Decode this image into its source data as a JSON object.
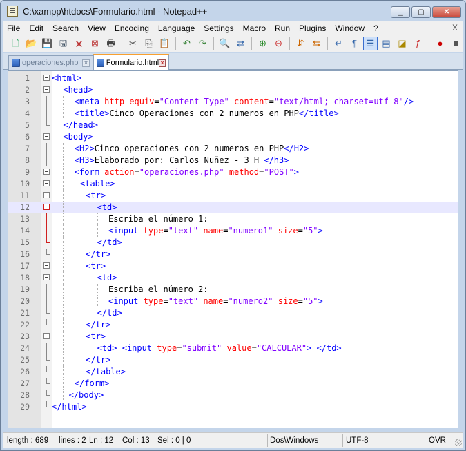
{
  "window": {
    "title": "C:\\xampp\\htdocs\\Formulario.html - Notepad++"
  },
  "title_buttons": {
    "minimize": "▁",
    "maximize": "▢",
    "close": "✕"
  },
  "menu": [
    "File",
    "Edit",
    "Search",
    "View",
    "Encoding",
    "Language",
    "Settings",
    "Macro",
    "Run",
    "Plugins",
    "Window",
    "?"
  ],
  "menu_close": "X",
  "toolbar": [
    {
      "name": "new-file-icon",
      "glyph": "🗋",
      "color": "#3a6"
    },
    {
      "name": "open-file-icon",
      "glyph": "📂",
      "color": "#c90"
    },
    {
      "name": "save-icon",
      "glyph": "💾",
      "color": "#456"
    },
    {
      "name": "save-all-icon",
      "glyph": "🖫",
      "color": "#456"
    },
    {
      "name": "close-icon",
      "glyph": "🗙",
      "color": "#b33"
    },
    {
      "name": "close-all-icon",
      "glyph": "⊠",
      "color": "#b33"
    },
    {
      "name": "print-icon",
      "glyph": "🖶",
      "color": "#444"
    },
    {
      "sep": true
    },
    {
      "name": "cut-icon",
      "glyph": "✂",
      "color": "#555"
    },
    {
      "name": "copy-icon",
      "glyph": "⎘",
      "color": "#555"
    },
    {
      "name": "paste-icon",
      "glyph": "📋",
      "color": "#a70"
    },
    {
      "sep": true
    },
    {
      "name": "undo-icon",
      "glyph": "↶",
      "color": "#2a7a2a"
    },
    {
      "name": "redo-icon",
      "glyph": "↷",
      "color": "#2a7a2a"
    },
    {
      "sep": true
    },
    {
      "name": "find-icon",
      "glyph": "🔍",
      "color": "#333"
    },
    {
      "name": "replace-icon",
      "glyph": "⇄",
      "color": "#36a"
    },
    {
      "sep": true
    },
    {
      "name": "zoom-in-icon",
      "glyph": "⊕",
      "color": "#2a8a2a"
    },
    {
      "name": "zoom-out-icon",
      "glyph": "⊖",
      "color": "#c33"
    },
    {
      "sep": true
    },
    {
      "name": "sync-vertical-icon",
      "glyph": "⇵",
      "color": "#c60"
    },
    {
      "name": "sync-horizontal-icon",
      "glyph": "⇆",
      "color": "#c60"
    },
    {
      "sep": true
    },
    {
      "name": "word-wrap-icon",
      "glyph": "↵",
      "color": "#36a"
    },
    {
      "name": "show-all-characters-icon",
      "glyph": "¶",
      "color": "#36a"
    },
    {
      "name": "indent-guide-icon",
      "glyph": "☰",
      "color": "#36a",
      "active": true
    },
    {
      "name": "user-language-icon",
      "glyph": "▤",
      "color": "#36a"
    },
    {
      "name": "document-map-icon",
      "glyph": "◪",
      "color": "#a80"
    },
    {
      "name": "function-list-icon",
      "glyph": "ƒ",
      "color": "#c33"
    },
    {
      "sep": true
    },
    {
      "name": "record-macro-icon",
      "glyph": "●",
      "color": "#c00"
    },
    {
      "name": "stop-record-icon",
      "glyph": "■",
      "color": "#555"
    }
  ],
  "tabs": [
    {
      "label": "operaciones.php",
      "active": false
    },
    {
      "label": "Formulario.html",
      "active": true
    }
  ],
  "editor": {
    "current_line": 12,
    "lines": [
      {
        "n": "1",
        "indent": 0,
        "fold": "box",
        "tokens": [
          [
            "t",
            "<html>"
          ]
        ]
      },
      {
        "n": "2",
        "indent": 2,
        "fold": "box",
        "tokens": [
          [
            "t",
            "<head>"
          ]
        ]
      },
      {
        "n": "3",
        "indent": 4,
        "fold": "line",
        "tokens": [
          [
            "t",
            "<meta "
          ],
          [
            "a",
            "http-equiv"
          ],
          [
            "p",
            "="
          ],
          [
            "v",
            "\"Content-Type\""
          ],
          [
            "p",
            " "
          ],
          [
            "a",
            "content"
          ],
          [
            "p",
            "="
          ],
          [
            "v",
            "\"text/html; charset=utf-8\""
          ],
          [
            "t",
            "/>"
          ]
        ]
      },
      {
        "n": "4",
        "indent": 4,
        "fold": "line",
        "tokens": [
          [
            "t",
            "<title>"
          ],
          [
            "p",
            "Cinco Operaciones con 2 numeros en PHP"
          ],
          [
            "t",
            "</title>"
          ]
        ]
      },
      {
        "n": "5",
        "indent": 2,
        "fold": "end",
        "tokens": [
          [
            "t",
            "</head>"
          ]
        ]
      },
      {
        "n": "6",
        "indent": 2,
        "fold": "box",
        "tokens": [
          [
            "t",
            "<body>"
          ]
        ]
      },
      {
        "n": "7",
        "indent": 4,
        "fold": "line",
        "tokens": [
          [
            "t",
            "<H2>"
          ],
          [
            "p",
            "Cinco operaciones con 2 numeros en PHP"
          ],
          [
            "t",
            "</H2>"
          ]
        ]
      },
      {
        "n": "8",
        "indent": 4,
        "fold": "line",
        "tokens": [
          [
            "t",
            "<H3>"
          ],
          [
            "p",
            "Elaborado por: Carlos Nuñez - 3 H "
          ],
          [
            "t",
            "</h3>"
          ]
        ]
      },
      {
        "n": "9",
        "indent": 4,
        "fold": "box",
        "tokens": [
          [
            "t",
            "<form "
          ],
          [
            "a",
            "action"
          ],
          [
            "p",
            "="
          ],
          [
            "v",
            "\"operaciones.php\""
          ],
          [
            "p",
            " "
          ],
          [
            "a",
            "method"
          ],
          [
            "p",
            "="
          ],
          [
            "v",
            "\"POST\""
          ],
          [
            "t",
            ">"
          ]
        ]
      },
      {
        "n": "10",
        "indent": 5,
        "fold": "box",
        "tokens": [
          [
            "t",
            "<table>"
          ]
        ]
      },
      {
        "n": "11",
        "indent": 6,
        "fold": "box",
        "tokens": [
          [
            "t",
            "<tr>"
          ]
        ]
      },
      {
        "n": "12",
        "indent": 8,
        "fold": "boxred",
        "tokens": [
          [
            "t",
            "<td>"
          ]
        ]
      },
      {
        "n": "13",
        "indent": 10,
        "fold": "linered",
        "tokens": [
          [
            "p",
            "Escriba el número 1:"
          ]
        ]
      },
      {
        "n": "14",
        "indent": 10,
        "fold": "linered",
        "tokens": [
          [
            "t",
            "<input "
          ],
          [
            "a",
            "type"
          ],
          [
            "p",
            "="
          ],
          [
            "v",
            "\"text\""
          ],
          [
            "p",
            " "
          ],
          [
            "a",
            "name"
          ],
          [
            "p",
            "="
          ],
          [
            "v",
            "\"numero1\""
          ],
          [
            "p",
            " "
          ],
          [
            "a",
            "size"
          ],
          [
            "p",
            "="
          ],
          [
            "v",
            "\"5\""
          ],
          [
            "t",
            ">"
          ]
        ]
      },
      {
        "n": "15",
        "indent": 8,
        "fold": "endred",
        "tokens": [
          [
            "t",
            "</td>"
          ]
        ]
      },
      {
        "n": "16",
        "indent": 6,
        "fold": "end",
        "tokens": [
          [
            "t",
            "</tr>"
          ]
        ]
      },
      {
        "n": "17",
        "indent": 6,
        "fold": "box",
        "tokens": [
          [
            "t",
            "<tr>"
          ]
        ]
      },
      {
        "n": "18",
        "indent": 8,
        "fold": "box",
        "tokens": [
          [
            "t",
            "<td>"
          ]
        ]
      },
      {
        "n": "19",
        "indent": 10,
        "fold": "line",
        "tokens": [
          [
            "p",
            "Escriba el número 2:"
          ]
        ]
      },
      {
        "n": "20",
        "indent": 10,
        "fold": "line",
        "tokens": [
          [
            "t",
            "<input "
          ],
          [
            "a",
            "type"
          ],
          [
            "p",
            "="
          ],
          [
            "v",
            "\"text\""
          ],
          [
            "p",
            " "
          ],
          [
            "a",
            "name"
          ],
          [
            "p",
            "="
          ],
          [
            "v",
            "\"numero2\""
          ],
          [
            "p",
            " "
          ],
          [
            "a",
            "size"
          ],
          [
            "p",
            "="
          ],
          [
            "v",
            "\"5\""
          ],
          [
            "t",
            ">"
          ]
        ]
      },
      {
        "n": "21",
        "indent": 8,
        "fold": "end",
        "tokens": [
          [
            "t",
            "</td>"
          ]
        ]
      },
      {
        "n": "22",
        "indent": 6,
        "fold": "end",
        "tokens": [
          [
            "t",
            "</tr>"
          ]
        ]
      },
      {
        "n": "23",
        "indent": 6,
        "fold": "box",
        "tokens": [
          [
            "t",
            "<tr>"
          ]
        ]
      },
      {
        "n": "24",
        "indent": 8,
        "fold": "line",
        "tokens": [
          [
            "t",
            "<td> <input "
          ],
          [
            "a",
            "type"
          ],
          [
            "p",
            "="
          ],
          [
            "v",
            "\"submit\""
          ],
          [
            "p",
            " "
          ],
          [
            "a",
            "value"
          ],
          [
            "p",
            "="
          ],
          [
            "v",
            "\"CALCULAR\""
          ],
          [
            "t",
            "> </td>"
          ]
        ]
      },
      {
        "n": "25",
        "indent": 6,
        "fold": "end",
        "tokens": [
          [
            "t",
            "</tr>"
          ]
        ]
      },
      {
        "n": "26",
        "indent": 6,
        "fold": "end",
        "tokens": [
          [
            "t",
            "</table>"
          ]
        ]
      },
      {
        "n": "27",
        "indent": 4,
        "fold": "end",
        "tokens": [
          [
            "t",
            "</form>"
          ]
        ]
      },
      {
        "n": "28",
        "indent": 3,
        "fold": "end",
        "tokens": [
          [
            "t",
            "</body>"
          ]
        ]
      },
      {
        "n": "29",
        "indent": 0,
        "fold": "end",
        "tokens": [
          [
            "t",
            "</html>"
          ]
        ]
      }
    ]
  },
  "colors": {
    "tag": "#0000ff",
    "attribute": "#ff0000",
    "value": "#8000ff",
    "text": "#000000"
  },
  "statusbar": {
    "length": "length : 689",
    "lines": "lines : 2",
    "ln": "Ln : 12",
    "col": "Col : 13",
    "sel": "Sel : 0 | 0",
    "eol": "Dos\\Windows",
    "encoding": "UTF-8",
    "mode": "OVR"
  }
}
